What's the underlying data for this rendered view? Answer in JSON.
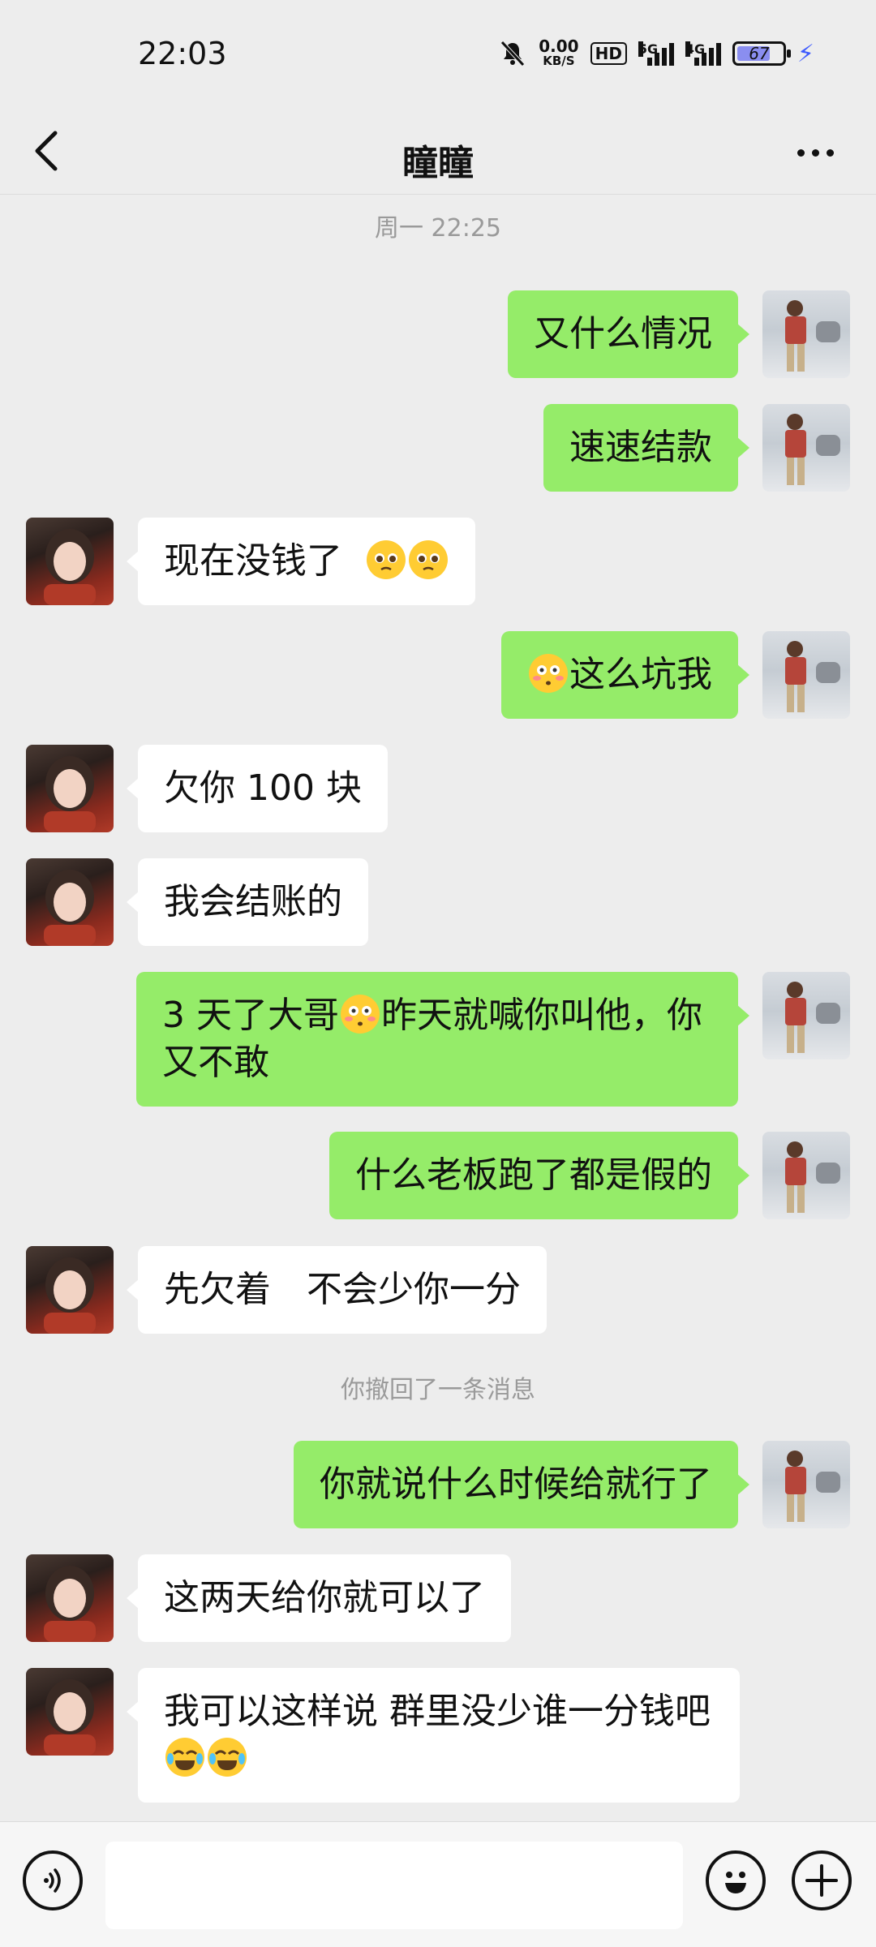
{
  "status_bar": {
    "time": "22:03",
    "net_speed_value": "0.00",
    "net_speed_unit": "KB/S",
    "hd_label": "HD",
    "sig1_label": "5G",
    "sig2_label": "4G",
    "battery_level": "67"
  },
  "header": {
    "title": "瞳瞳"
  },
  "messages": [
    {
      "type": "timestamp",
      "text": "周一 22:25"
    },
    {
      "type": "out",
      "text": "又什么情况"
    },
    {
      "type": "out",
      "text": "速速结款"
    },
    {
      "type": "in",
      "text": "现在没钱了",
      "emoji": "pleading-face-emoji x2"
    },
    {
      "type": "out",
      "text": "这么坑我",
      "emoji": "flushed-face-emoji"
    },
    {
      "type": "in",
      "text": "欠你 100 块"
    },
    {
      "type": "in",
      "text": "我会结账的"
    },
    {
      "type": "out",
      "text_a": "3 天了大哥",
      "text_b": "昨天就喊你叫他，你又不敢",
      "emoji": "flushed-face-emoji"
    },
    {
      "type": "out",
      "text": "什么老板跑了都是假的"
    },
    {
      "type": "in",
      "text": "先欠着　不会少你一分"
    },
    {
      "type": "system",
      "text": "你撤回了一条消息"
    },
    {
      "type": "out",
      "text": "你就说什么时候给就行了"
    },
    {
      "type": "in",
      "text": "这两天给你就可以了"
    },
    {
      "type": "in",
      "text": "我可以这样说  群里没少谁一分钱吧",
      "emoji": "crying-laughing-emoji x2"
    }
  ],
  "input": {
    "value": "",
    "placeholder": ""
  },
  "colors": {
    "background": "#EDEDED",
    "outgoing_bubble": "#95EC69",
    "incoming_bubble": "#FFFFFF"
  }
}
